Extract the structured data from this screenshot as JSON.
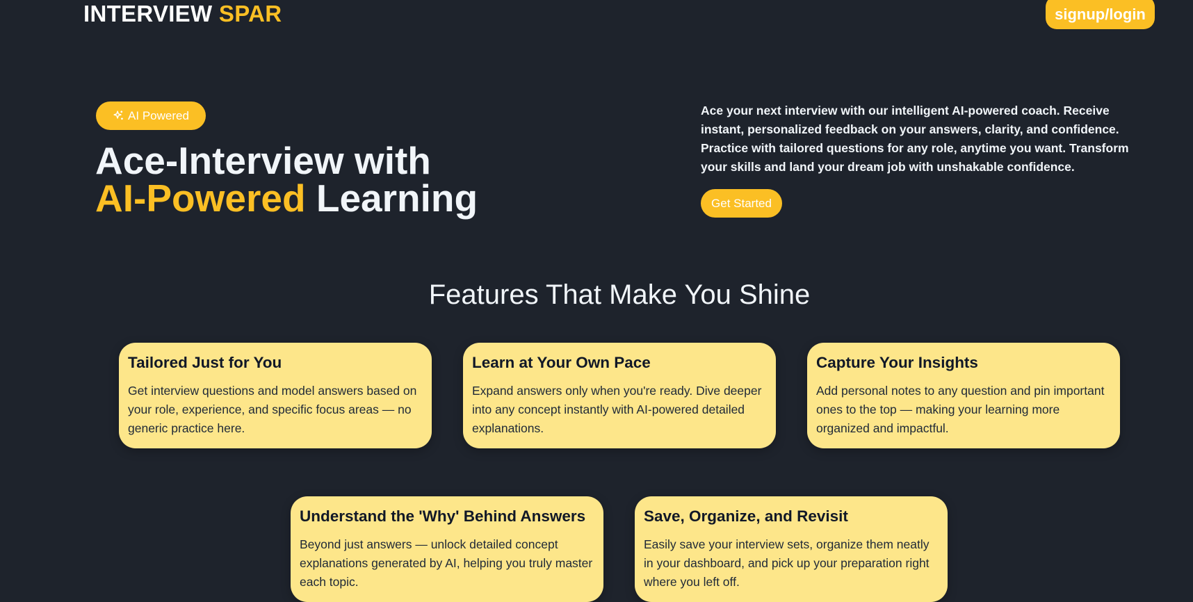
{
  "header": {
    "logo_main": "INTERVIEW ",
    "logo_accent": "SPAR",
    "auth_button": "signup/login"
  },
  "hero": {
    "badge_label": "AI Powered",
    "badge_icon": "sparkles-icon",
    "title_line1": "Ace-Interview with",
    "title_accent": "AI-Powered",
    "title_rest": " Learning",
    "description": "Ace your next interview with our intelligent AI-powered coach. Receive instant, personalized feedback on your answers, clarity, and confidence. Practice with tailored questions for any role, anytime you want. Transform your skills and land your dream job with unshakable confidence.",
    "cta_label": "Get Started"
  },
  "features": {
    "title": "Features That Make You Shine",
    "items": [
      {
        "title": "Tailored Just for You",
        "description": "Get interview questions and model answers based on your role, experience, and specific focus areas — no generic practice here."
      },
      {
        "title": "Learn at Your Own Pace",
        "description": "Expand answers only when you're ready. Dive deeper into any concept instantly with AI-powered detailed explanations."
      },
      {
        "title": "Capture Your Insights",
        "description": "Add personal notes to any question and pin important ones to the top — making your learning more organized and impactful."
      },
      {
        "title": "Understand the 'Why' Behind Answers",
        "description": "Beyond just answers — unlock detailed concept explanations generated by AI, helping you truly master each topic."
      },
      {
        "title": "Save, Organize, and Revisit",
        "description": "Easily save your interview sets, organize them neatly in your dashboard, and pick up your preparation right where you left off."
      }
    ]
  },
  "colors": {
    "background": "#1e232c",
    "accent": "#fbbf24",
    "card": "#fde68a"
  }
}
